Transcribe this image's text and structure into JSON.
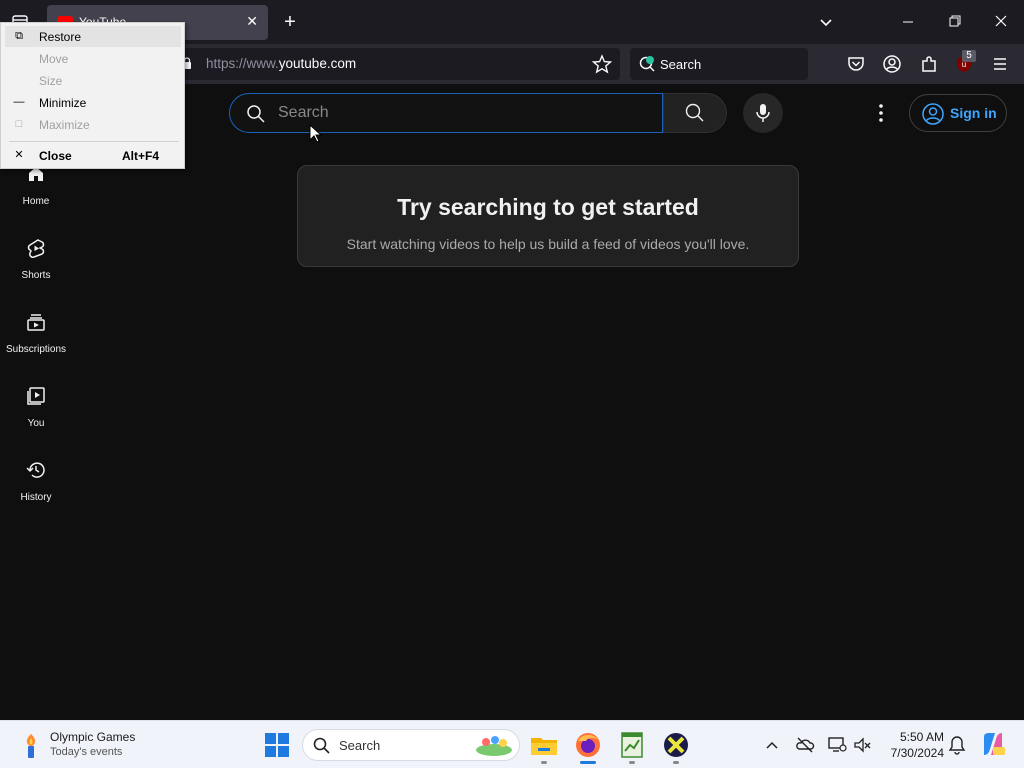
{
  "browser": {
    "tab_title": "YouTube",
    "url_prefix": "https://www.",
    "url_domain": "youtube.com",
    "web_search_label": "Search",
    "extension_badge": "5"
  },
  "system_menu": {
    "items": [
      {
        "label": "Restore",
        "icon": "restore-icon",
        "enabled": true,
        "selected": true
      },
      {
        "label": "Move",
        "enabled": false
      },
      {
        "label": "Size",
        "enabled": false
      },
      {
        "label": "Minimize",
        "icon": "minimize-icon",
        "enabled": true
      },
      {
        "label": "Maximize",
        "icon": "maximize-icon",
        "enabled": false
      },
      {
        "label": "Close",
        "icon": "close-icon",
        "enabled": true,
        "accelerator": "Alt+F4"
      }
    ]
  },
  "youtube": {
    "search_placeholder": "Search",
    "sign_in_label": "Sign in",
    "sidebar": [
      {
        "label": "Home",
        "icon": "home-icon"
      },
      {
        "label": "Shorts",
        "icon": "shorts-icon"
      },
      {
        "label": "Subscriptions",
        "icon": "subscriptions-icon"
      },
      {
        "label": "You",
        "icon": "you-icon"
      },
      {
        "label": "History",
        "icon": "history-icon"
      }
    ],
    "prompt_heading": "Try searching to get started",
    "prompt_sub": "Start watching videos to help us build a feed of videos you'll love."
  },
  "taskbar": {
    "news_title": "Olympic Games",
    "news_sub": "Today's events",
    "search_label": "Search",
    "time": "5:50 AM",
    "date": "7/30/2024"
  },
  "colors": {
    "accent_blue": "#3ea6ff",
    "search_focus": "#1c62b9",
    "page_bg": "#0f0f0f"
  }
}
